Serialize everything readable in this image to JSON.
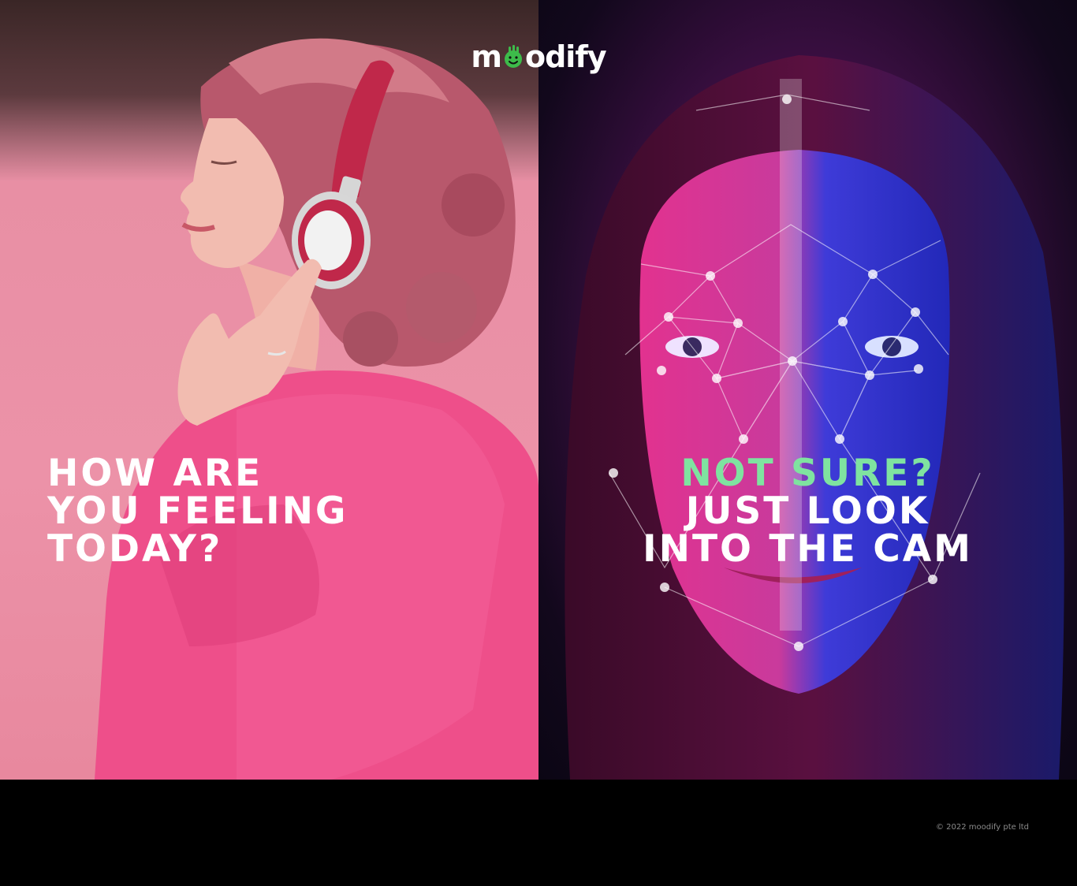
{
  "brand": {
    "name_prefix": "m",
    "name_suffix": "odify",
    "accent_color": "#3dbb4a",
    "icon": "smiley-icon"
  },
  "left_panel": {
    "headline_lines": [
      "HOW ARE",
      "YOU FEELING",
      "TODAY?"
    ],
    "image": "woman-with-headphones-photo"
  },
  "right_panel": {
    "accent_line": "NOT SURE?",
    "headline_lines": [
      "JUST LOOK",
      "INTO THE CAM"
    ],
    "accent_color": "#7fe3a0",
    "image": "face-recognition-photo"
  },
  "footer": {
    "copyright": "© 2022 moodify pte ltd"
  }
}
